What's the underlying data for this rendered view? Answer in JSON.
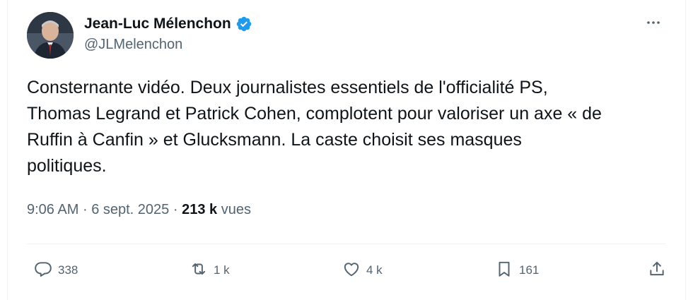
{
  "author": {
    "name": "Jean-Luc Mélenchon",
    "handle": "@JLMelenchon",
    "verified": true,
    "verified_color": "#1d9bf0"
  },
  "menu": {
    "more_icon": "more-icon"
  },
  "tweet": {
    "text": "Consternante vidéo. Deux journalistes essentiels de l'officialité PS,\nThomas Legrand et Patrick Cohen, complotent pour valoriser un axe « de\nRuffin à Canfin » et Glucksmann. La caste choisit ses masques\npolitiques."
  },
  "meta": {
    "time": "9:06 AM",
    "separator": "·",
    "date": "6 sept. 2025",
    "views_count": "213 k",
    "views_label": "vues"
  },
  "actions": {
    "replies": "338",
    "reposts": "1 k",
    "likes": "4 k",
    "bookmarks": "161"
  },
  "colors": {
    "text": "#0f1419",
    "secondary": "#536471",
    "border": "#eff3f4",
    "accent": "#1d9bf0"
  }
}
